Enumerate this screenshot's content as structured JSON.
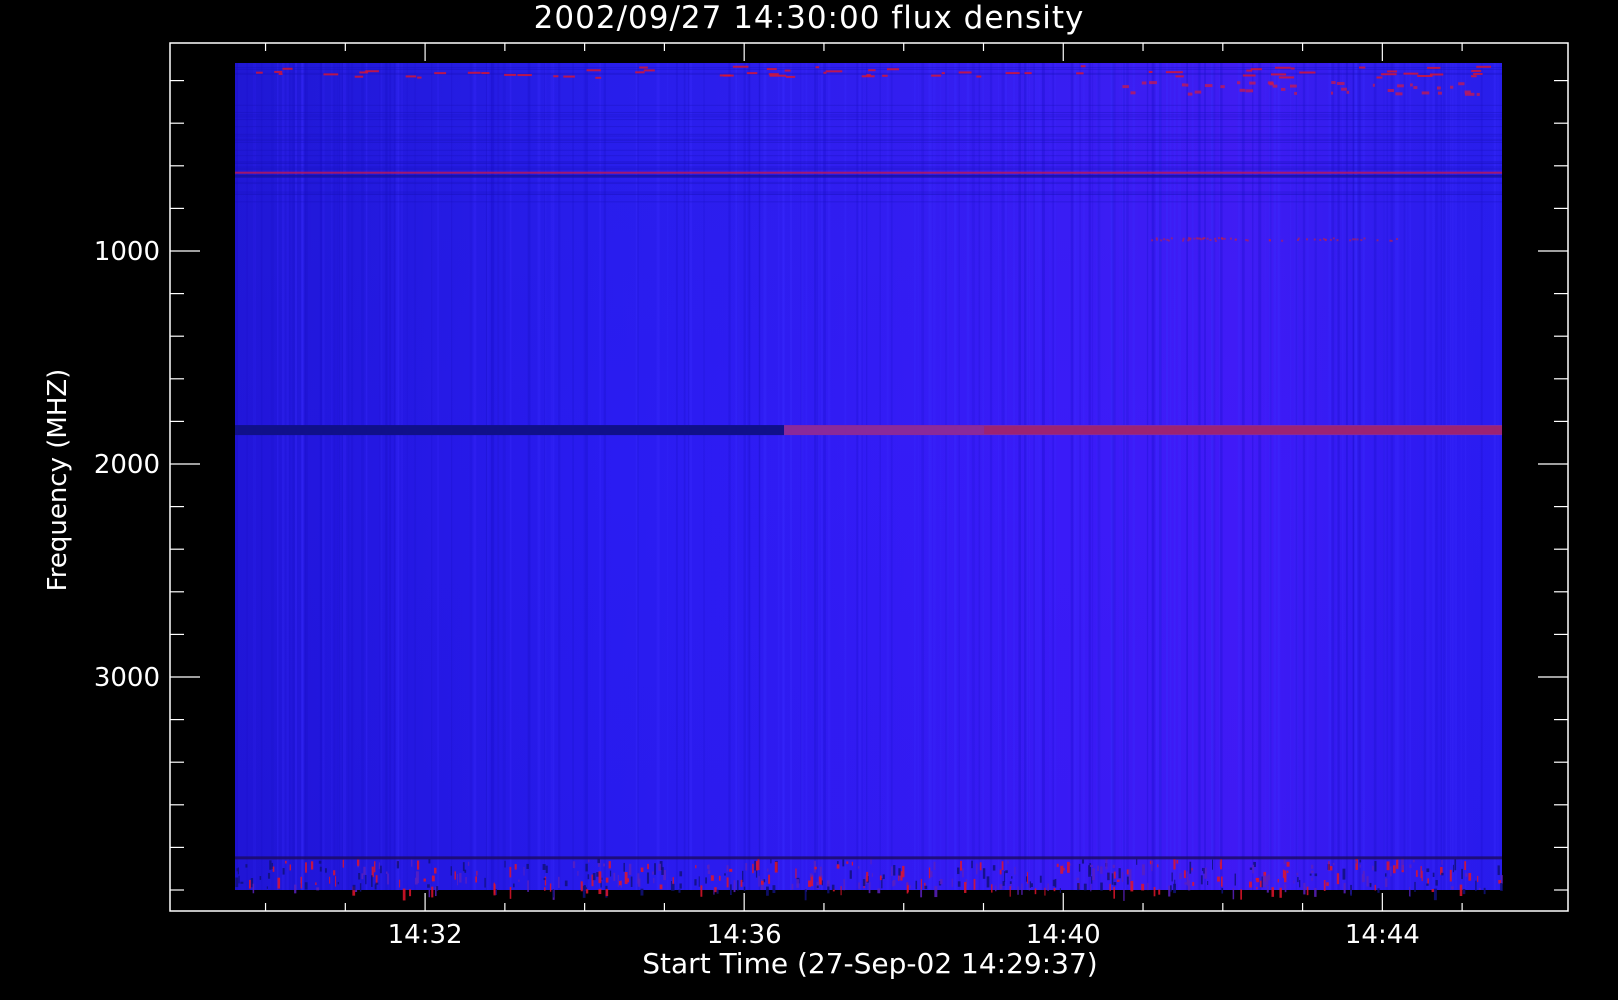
{
  "chart_data": {
    "type": "heatmap",
    "title": "2002/09/27 14:30:00 flux density",
    "xlabel": "Start Time (27-Sep-02 14:29:37)",
    "ylabel": "Frequency (MHZ)",
    "x_ticks": [
      "14:32",
      "14:36",
      "14:40",
      "14:44"
    ],
    "x_tick_minutes": [
      32,
      36,
      40,
      44
    ],
    "xlim_minutes": [
      29.617,
      45.5
    ],
    "y_ticks": [
      1000,
      2000,
      3000
    ],
    "ylim_mhz": [
      4100,
      0
    ],
    "grid": false,
    "colors": {
      "background": "#000000",
      "base": "#2a1cf5",
      "hot": "#e0142a",
      "axis": "#ffffff"
    },
    "features": [
      {
        "kind": "horizontal-band",
        "freq_mhz": 1820,
        "note_start_minute": 36.5,
        "color": "hot"
      },
      {
        "kind": "horizontal-band",
        "freq_mhz": 600,
        "color": "hot"
      },
      {
        "kind": "noisy-edge",
        "freq_mhz_range": [
          3850,
          4000
        ]
      },
      {
        "kind": "noisy-edge",
        "freq_mhz_range": [
          80,
          200
        ]
      }
    ]
  }
}
